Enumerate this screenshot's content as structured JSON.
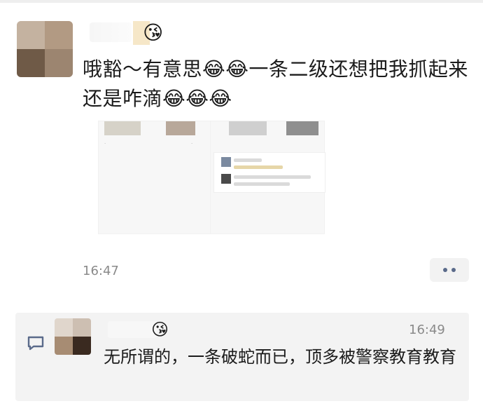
{
  "post": {
    "name_emoji": "😘",
    "text": "哦豁～有意思😂😂一条二级还想把我抓起来还是咋滴😂😂😂",
    "time": "16:47"
  },
  "icons": {
    "more": "more-dots-icon",
    "comment": "comment-icon"
  },
  "comment": {
    "name_emoji": "😘",
    "time": "16:49",
    "text": "无所谓的，一条破蛇而已，顶多被警察教育教育"
  },
  "colors": {
    "accent_blue": "#5a6a8a",
    "comment_bg": "#f3f3f3",
    "time_gray": "#8a8a8a"
  }
}
